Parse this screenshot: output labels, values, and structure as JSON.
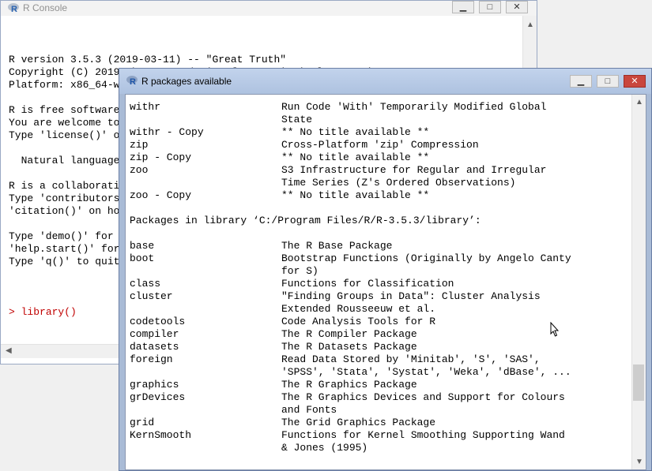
{
  "console": {
    "title": "R Console",
    "lines": [
      "",
      "R version 3.5.3 (2019-03-11) -- \"Great Truth\"",
      "Copyright (C) 2019 The R Foundation for Statistical Computing",
      "Platform: x86_64-w64-mingw32/x64 (64-bit)",
      "",
      "R is free software and comes with ABSOLUTELY NO WARRANTY.",
      "You are welcome to redistribute it under certain conditions.",
      "Type 'license()' or 'licence()' for distribution details.",
      "",
      "  Natural language support but running in an English locale",
      "",
      "R is a collaborative project with many contributors.",
      "Type 'contributors()' for more information and",
      "'citation()' on how to cite R or R packages in publications.",
      "",
      "Type 'demo()' for some demos, 'help()' for on-line help, or",
      "'help.start()' for an HTML browser interface to help.",
      "Type 'q()' to quit R.",
      ""
    ],
    "cmd_prompt": "> ",
    "cmd_text": "library()",
    "input_prompt": "> ",
    "buttons": {
      "minimize": "▁",
      "maximize": "□",
      "close": "✕"
    },
    "colors": {
      "prompt": "#c00000"
    }
  },
  "packages_window": {
    "title": "R packages available",
    "buttons": {
      "minimize": "▁",
      "maximize": "□",
      "close": "✕"
    },
    "rows": [
      {
        "name": "withr",
        "desc": "Run Code 'With' Temporarily Modified Global"
      },
      {
        "name": "",
        "desc": "State"
      },
      {
        "name": "withr - Copy",
        "desc": "** No title available **"
      },
      {
        "name": "zip",
        "desc": "Cross-Platform 'zip' Compression"
      },
      {
        "name": "zip - Copy",
        "desc": "** No title available **"
      },
      {
        "name": "zoo",
        "desc": "S3 Infrastructure for Regular and Irregular"
      },
      {
        "name": "",
        "desc": "Time Series (Z's Ordered Observations)"
      },
      {
        "name": "zoo - Copy",
        "desc": "** No title available **"
      },
      {
        "name": "",
        "desc": ""
      },
      {
        "name": "Packages in library ‘C:/Program Files/R/R-3.5.3/library’:",
        "desc": ""
      },
      {
        "name": "",
        "desc": ""
      },
      {
        "name": "base",
        "desc": "The R Base Package"
      },
      {
        "name": "boot",
        "desc": "Bootstrap Functions (Originally by Angelo Canty"
      },
      {
        "name": "",
        "desc": "for S)"
      },
      {
        "name": "class",
        "desc": "Functions for Classification"
      },
      {
        "name": "cluster",
        "desc": "\"Finding Groups in Data\": Cluster Analysis"
      },
      {
        "name": "",
        "desc": "Extended Rousseeuw et al."
      },
      {
        "name": "codetools",
        "desc": "Code Analysis Tools for R"
      },
      {
        "name": "compiler",
        "desc": "The R Compiler Package"
      },
      {
        "name": "datasets",
        "desc": "The R Datasets Package"
      },
      {
        "name": "foreign",
        "desc": "Read Data Stored by 'Minitab', 'S', 'SAS',"
      },
      {
        "name": "",
        "desc": "'SPSS', 'Stata', 'Systat', 'Weka', 'dBase', ..."
      },
      {
        "name": "graphics",
        "desc": "The R Graphics Package"
      },
      {
        "name": "grDevices",
        "desc": "The R Graphics Devices and Support for Colours"
      },
      {
        "name": "",
        "desc": "and Fonts"
      },
      {
        "name": "grid",
        "desc": "The Grid Graphics Package"
      },
      {
        "name": "KernSmooth",
        "desc": "Functions for Kernel Smoothing Supporting Wand"
      },
      {
        "name": "",
        "desc": "& Jones (1995)"
      }
    ],
    "scroll_position": 0.82
  }
}
